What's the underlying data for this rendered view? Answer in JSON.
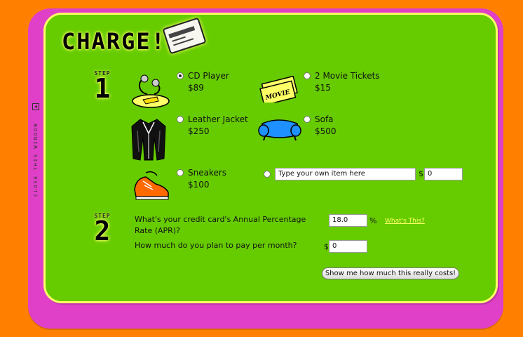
{
  "sidebar": {
    "close_label": "CLOSE THIS WINDOW"
  },
  "header": {
    "title": "CHARGE!"
  },
  "step1": {
    "label": "STEP",
    "number": "1"
  },
  "step2": {
    "label": "STEP",
    "number": "2"
  },
  "items": [
    {
      "name": "CD Player",
      "price": "$89",
      "selected": true
    },
    {
      "name": "2 Movie Tickets",
      "price": "$15",
      "selected": false
    },
    {
      "name": "Leather Jacket",
      "price": "$250",
      "selected": false
    },
    {
      "name": "Sofa",
      "price": "$500",
      "selected": false
    },
    {
      "name": "Sneakers",
      "price": "$100",
      "selected": false
    }
  ],
  "custom_item": {
    "placeholder": "Type your own item here",
    "currency": "$",
    "amount": "0"
  },
  "ticket_text": "MOVIE",
  "apr": {
    "question": "What's your credit card's Annual Percentage Rate (APR)?",
    "value": "18.0",
    "unit": "%",
    "help_link": "What's This?"
  },
  "payment": {
    "question": "How much do you plan to pay per month?",
    "currency": "$",
    "value": "0"
  },
  "submit_label": "Show me how much this really costs!"
}
